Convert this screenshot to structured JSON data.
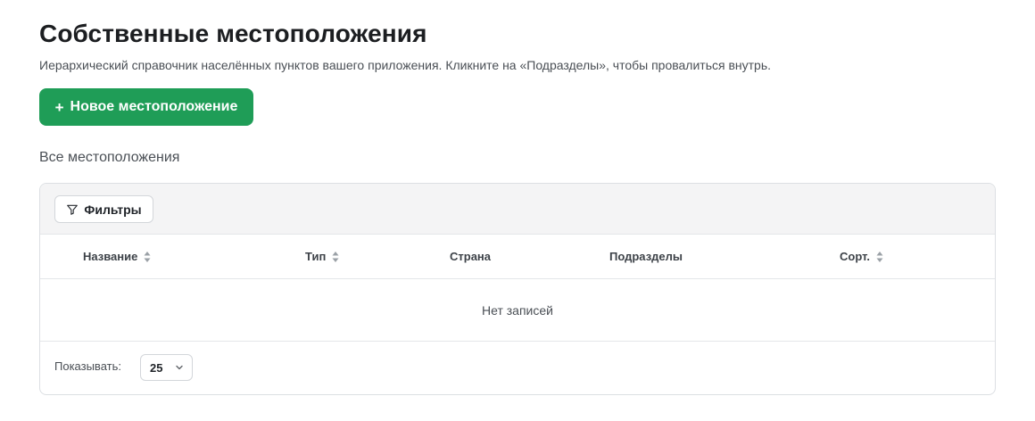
{
  "header": {
    "title": "Собственные местоположения",
    "subtitle": "Иерархический справочник населённых пунктов вашего приложения. Кликните на «Подразделы», чтобы провалиться внутрь."
  },
  "actions": {
    "new_button_icon": "plus-icon",
    "new_button_label": "Новое местоположение"
  },
  "section": {
    "label": "Все местоположения"
  },
  "table": {
    "filters_label": "Фильтры",
    "filters_icon": "filter-icon",
    "columns": [
      {
        "label": "Название",
        "sortable": true
      },
      {
        "label": "Тип",
        "sortable": true
      },
      {
        "label": "Страна",
        "sortable": false
      },
      {
        "label": "Подразделы",
        "sortable": false
      },
      {
        "label": "Сорт.",
        "sortable": true
      }
    ],
    "empty_text": "Нет записей"
  },
  "pagination": {
    "show_label": "Показывать:",
    "page_size": "25"
  },
  "colors": {
    "primary": "#1f9d57",
    "toolbar_bg": "#f4f4f5",
    "border": "#dcdfe3"
  }
}
